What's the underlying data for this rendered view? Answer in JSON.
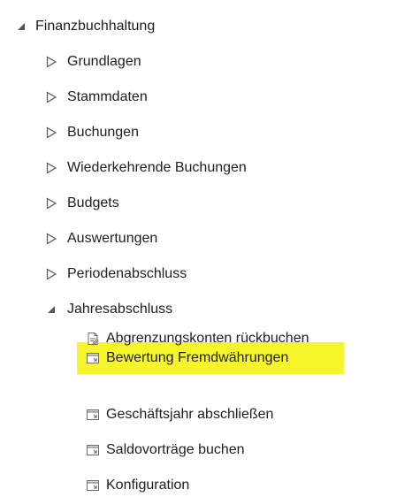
{
  "tree": {
    "root": {
      "label": "Finanzbuchhaltung",
      "icon": "collapse-triangle-icon",
      "expanded": true
    },
    "children": [
      {
        "label": "Grundlagen",
        "icon": "expand-triangle-icon",
        "expanded": false
      },
      {
        "label": "Stammdaten",
        "icon": "expand-triangle-icon",
        "expanded": false
      },
      {
        "label": "Buchungen",
        "icon": "expand-triangle-icon",
        "expanded": false
      },
      {
        "label": "Wiederkehrende Buchungen",
        "icon": "expand-triangle-icon",
        "expanded": false
      },
      {
        "label": "Budgets",
        "icon": "expand-triangle-icon",
        "expanded": false
      },
      {
        "label": "Auswertungen",
        "icon": "expand-triangle-icon",
        "expanded": false
      },
      {
        "label": "Periodenabschluss",
        "icon": "expand-triangle-icon",
        "expanded": false
      },
      {
        "label": "Jahresabschluss",
        "icon": "collapse-triangle-icon",
        "expanded": true
      }
    ],
    "jahresabschluss_items": [
      {
        "label": "Abgrenzungskonten rückbuchen",
        "icon": "document-edit-icon"
      },
      {
        "label": "Bewertung Fremdwährungen",
        "icon": "window-form-icon",
        "highlighted": true
      },
      {
        "label": "Geschäftsjahr abschließen",
        "icon": "window-form-icon"
      },
      {
        "label": "Saldovorträge buchen",
        "icon": "window-form-icon"
      },
      {
        "label": "Konfiguration",
        "icon": "window-form-icon"
      }
    ]
  },
  "colors": {
    "highlight": "#f5f52a",
    "text": "#1e1e1e",
    "expander": "#555555",
    "icon_stroke": "#6b6b6b"
  }
}
